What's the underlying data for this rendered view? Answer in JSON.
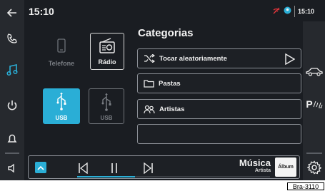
{
  "statusbar": {
    "clock": "15:10",
    "clock_small": "15:10"
  },
  "sources": {
    "telefone": "Telefone",
    "radio": "Rádio",
    "usb1": "USB",
    "usb2": "USB"
  },
  "categories": {
    "title": "Categorias",
    "items": [
      {
        "label": "Tocar aleatoriamente",
        "icon": "shuffle-icon"
      },
      {
        "label": "Pastas",
        "icon": "folder-icon"
      },
      {
        "label": "Artistas",
        "icon": "artists-icon"
      }
    ]
  },
  "player": {
    "title": "Música",
    "subtitle": "Artista",
    "album": "Álbum",
    "progress": 0.3
  },
  "right_bar": {
    "parking": "P"
  },
  "figure_tag": "Bra-3110",
  "colors": {
    "background": "#1a1d22",
    "sidebar": "#26292e",
    "accent": "#2aaed6",
    "selected_tile": "#2aaed6"
  }
}
